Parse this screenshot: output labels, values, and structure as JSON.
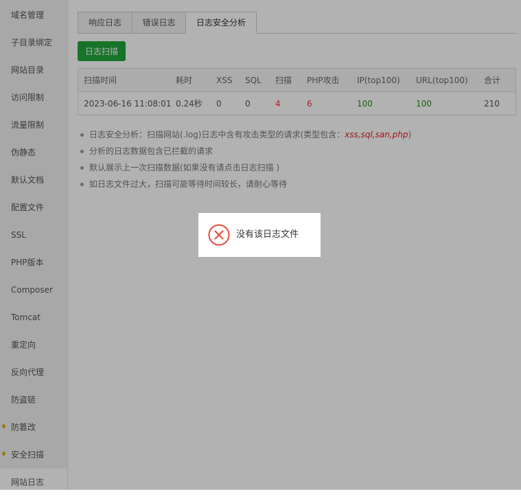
{
  "sidebar": {
    "items": [
      {
        "label": "域名管理"
      },
      {
        "label": "子目录绑定"
      },
      {
        "label": "网站目录"
      },
      {
        "label": "访问限制"
      },
      {
        "label": "流量限制"
      },
      {
        "label": "伪静态"
      },
      {
        "label": "默认文档"
      },
      {
        "label": "配置文件"
      },
      {
        "label": "SSL"
      },
      {
        "label": "PHP版本"
      },
      {
        "label": "Composer"
      },
      {
        "label": "Tomcat"
      },
      {
        "label": "重定向"
      },
      {
        "label": "反向代理"
      },
      {
        "label": "防盗链"
      },
      {
        "label": "防篡改",
        "icon": "diamond-icon"
      },
      {
        "label": "安全扫描",
        "icon": "diamond-icon"
      },
      {
        "label": "网站日志",
        "active": true
      }
    ]
  },
  "tabs": [
    {
      "label": "响应日志"
    },
    {
      "label": "错误日志"
    },
    {
      "label": "日志安全分析",
      "active": true
    }
  ],
  "scan_button": {
    "label": "日志扫描"
  },
  "table": {
    "headers": [
      "扫描时间",
      "耗时",
      "XSS",
      "SQL",
      "扫描",
      "PHP攻击",
      "IP(top100)",
      "URL(top100)",
      "合计"
    ],
    "row": [
      "2023-06-16 11:08:01",
      "0.24秒",
      "0",
      "0",
      "4",
      "6",
      "100",
      "100",
      "210"
    ]
  },
  "tips": {
    "tip1_prefix": "日志安全分析：扫描网站(.log)日志中含有攻击类型的请求(类型包含：",
    "tip1_types": "xss,sql,san,php",
    "tip1_suffix": ")",
    "tip2": "分析的日志数据包含已拦截的请求",
    "tip3": "默认展示上一次扫描数据(如果没有请点击日志扫描 )",
    "tip4": "如日志文件过大，扫描可能等待时间较长，请耐心等待"
  },
  "toast": {
    "message": "没有该日志文件",
    "icon": "error-circle-icon"
  },
  "colors": {
    "primary_green": "#20a53a",
    "danger_red": "#ee3333",
    "success_green": "#2a8a1a",
    "toast_icon": "#e74c3c"
  }
}
